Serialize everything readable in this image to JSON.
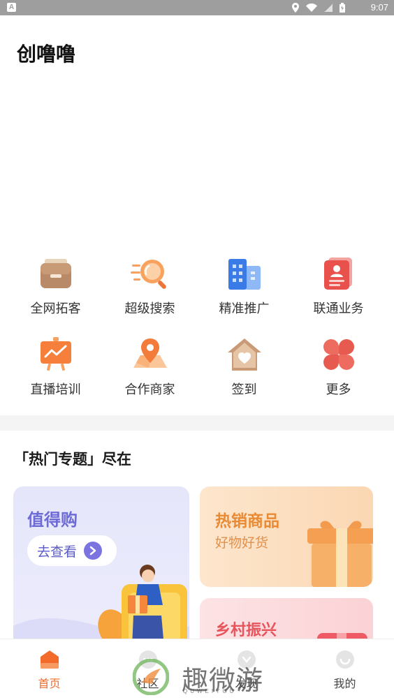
{
  "status_bar": {
    "time": "9:07",
    "notification": "A"
  },
  "app": {
    "title": "创噜噜"
  },
  "grid": {
    "items": [
      {
        "label": "全网拓客",
        "icon": "briefcase-icon"
      },
      {
        "label": "超级搜索",
        "icon": "search-icon"
      },
      {
        "label": "精准推广",
        "icon": "buildings-icon"
      },
      {
        "label": "联通业务",
        "icon": "document-icon"
      },
      {
        "label": "直播培训",
        "icon": "chart-board-icon"
      },
      {
        "label": "合作商家",
        "icon": "map-pin-icon"
      },
      {
        "label": "签到",
        "icon": "house-heart-icon"
      },
      {
        "label": "更多",
        "icon": "clover-icon"
      }
    ]
  },
  "section": {
    "title": "「热门专题」尽在"
  },
  "cards": {
    "left": {
      "title": "值得购",
      "button": "去查看"
    },
    "right_top": {
      "title": "热销商品",
      "subtitle": "好物好货"
    },
    "right_bottom": {
      "title": "乡村振兴"
    }
  },
  "tabbar": {
    "tabs": [
      {
        "label": "首页",
        "active": true
      },
      {
        "label": "社区",
        "active": false
      },
      {
        "label": "发现",
        "active": false
      },
      {
        "label": "我的",
        "active": false
      }
    ]
  },
  "watermark": {
    "text": "趣微游",
    "sub": "QUWEIYOU"
  },
  "colors": {
    "accent": "#f26b2a",
    "purple": "#6d6bd6",
    "orange": "#e98a35",
    "red": "#e8545c"
  }
}
